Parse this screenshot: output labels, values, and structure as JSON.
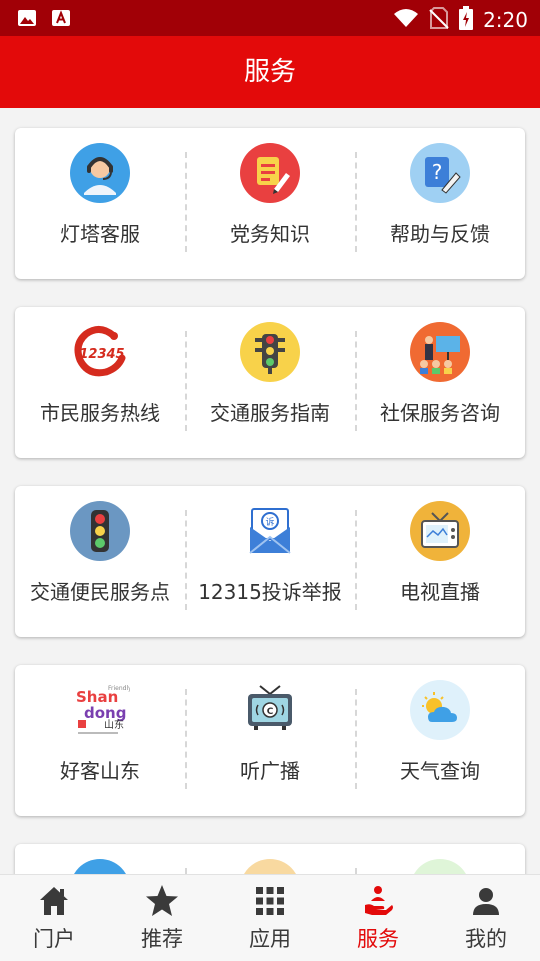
{
  "status_bar": {
    "time": "2:20"
  },
  "header": {
    "title": "服务"
  },
  "service_rows": [
    {
      "items": [
        {
          "label": "灯塔客服",
          "icon": "customer-service-icon"
        },
        {
          "label": "党务知识",
          "icon": "notepad-pen-icon"
        },
        {
          "label": "帮助与反馈",
          "icon": "help-feedback-icon"
        }
      ]
    },
    {
      "items": [
        {
          "label": "市民服务热线",
          "icon": "hotline-12345-logo"
        },
        {
          "label": "交通服务指南",
          "icon": "traffic-light-icon"
        },
        {
          "label": "社保服务咨询",
          "icon": "social-security-icon"
        }
      ]
    },
    {
      "items": [
        {
          "label": "交通便民服务点",
          "icon": "traffic-signal-icon"
        },
        {
          "label": "12315投诉举报",
          "icon": "complaint-envelope-icon"
        },
        {
          "label": "电视直播",
          "icon": "tv-icon"
        }
      ]
    },
    {
      "items": [
        {
          "label": "好客山东",
          "icon": "shandong-logo"
        },
        {
          "label": "听广播",
          "icon": "radio-icon"
        },
        {
          "label": "天气查询",
          "icon": "weather-icon"
        }
      ]
    }
  ],
  "tabs": [
    {
      "label": "门户",
      "icon": "home-icon",
      "active": false
    },
    {
      "label": "推荐",
      "icon": "star-icon",
      "active": false
    },
    {
      "label": "应用",
      "icon": "grid-icon",
      "active": false
    },
    {
      "label": "服务",
      "icon": "service-hand-icon",
      "active": true
    },
    {
      "label": "我的",
      "icon": "user-icon",
      "active": false
    }
  ],
  "colors": {
    "header": "#e30a0a",
    "status_bar": "#a10006",
    "active_tab": "#e30a0a"
  }
}
